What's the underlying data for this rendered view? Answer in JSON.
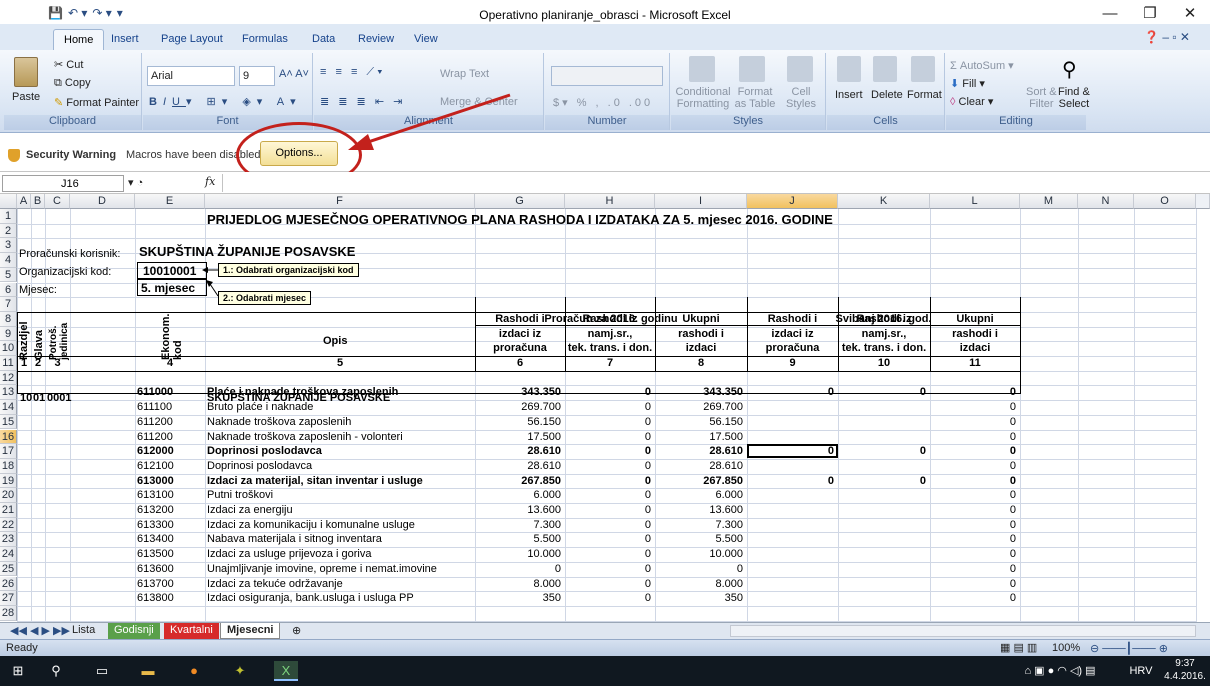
{
  "window": {
    "title": "Operativno planiranje_obrasci - Microsoft Excel",
    "controls": [
      "—",
      "❐",
      "✕"
    ]
  },
  "ribbon": {
    "tabs": [
      "Home",
      "Insert",
      "Page Layout",
      "Formulas",
      "Data",
      "Review",
      "View"
    ],
    "clipboard": {
      "paste": "Paste",
      "cut": "Cut",
      "copy": "Copy",
      "format_painter": "Format Painter",
      "group": "Clipboard"
    },
    "font": {
      "name": "Arial",
      "size": "9",
      "group": "Font"
    },
    "alignment": {
      "wrap": "Wrap Text",
      "merge": "Merge & Center",
      "group": "Alignment"
    },
    "number": {
      "group": "Number"
    },
    "styles": {
      "cond": "Conditional",
      "cond2": "Formatting",
      "fmt": "Format",
      "fmt2": "as Table",
      "cell": "Cell",
      "cell2": "Styles",
      "group": "Styles"
    },
    "cells": {
      "insert": "Insert",
      "delete": "Delete",
      "format": "Format",
      "group": "Cells"
    },
    "editing": {
      "autosum": "AutoSum",
      "fill": "Fill",
      "clear": "Clear",
      "sort": "Sort &",
      "sort2": "Filter",
      "find": "Find &",
      "find2": "Select",
      "group": "Editing"
    }
  },
  "security": {
    "title": "Security Warning",
    "message": "Macros have been disabled.",
    "button": "Options..."
  },
  "formula_bar": {
    "cell": "J16",
    "fx": "fx",
    "value": ""
  },
  "columns": [
    "A",
    "B",
    "C",
    "D",
    "E",
    "F",
    "G",
    "H",
    "I",
    "J",
    "K",
    "L",
    "M",
    "N",
    "O"
  ],
  "rows": [
    "1",
    "2",
    "3",
    "4",
    "5",
    "6",
    "7",
    "8",
    "9",
    "10",
    "11",
    "12",
    "13",
    "14",
    "15",
    "16",
    "17",
    "18",
    "19",
    "20",
    "21",
    "22",
    "23",
    "24",
    "25",
    "26",
    "27",
    "28"
  ],
  "sheet": {
    "title": "PRIJEDLOG MJESEČNOG OPERATIVNOG PLANA RASHODA I IZDATAKA ZA 5. mjesec 2016. GODINE",
    "korisnik_label": "Proračunski korisnik:",
    "korisnik": "SKUPŠTINA ŽUPANIJE POSAVSKE",
    "org_label": "Organizacijski kod:",
    "org": "10010001",
    "mj_label": "Mjesec:",
    "mj": "5. mjesec",
    "note1": "1.: Odabrati organizacijski kod",
    "note2": "2.: Odabrati mjesec",
    "hdr_razdjel": "Razdjel",
    "hdr_glava": "Glava",
    "hdr_potros": "Potroš. jedinica",
    "hdr_ekon": "Ekonom. kod",
    "hdr_opis": "Opis",
    "budget_hdr": "Proračun za 2016. godinu",
    "month_hdr": "Svibanj 2016. god.",
    "col_g": [
      "Rashodi i",
      "izdaci iz",
      "proračuna"
    ],
    "col_h": [
      "Rashodi iz",
      "namj.sr.,",
      "tek. trans. i don."
    ],
    "col_i": [
      "Ukupni",
      "rashodi i",
      "izdaci"
    ],
    "col_j": [
      "Rashodi i",
      "izdaci iz",
      "proračuna"
    ],
    "col_k": [
      "Rashodi iz",
      "namj.sr.,",
      "tek. trans. i don."
    ],
    "col_l": [
      "Ukupni",
      "rashodi i",
      "izdaci"
    ],
    "nums": [
      "1",
      "2",
      "3",
      "4",
      "5",
      "6",
      "7",
      "8",
      "9",
      "10",
      "11"
    ],
    "r12": {
      "a": "10",
      "b": "01",
      "c": "0001",
      "f": "SKUPŠTINA ŽUPANIJE POSAVSKE"
    },
    "data": [
      {
        "e": "611000",
        "f": "Plaće i naknade troškova zaposlenih",
        "g": "343.350",
        "h": "0",
        "i": "343.350",
        "j": "0",
        "k": "0",
        "l": "0",
        "bold": true
      },
      {
        "e": "611100",
        "f": "Bruto plaće i naknade",
        "g": "269.700",
        "h": "0",
        "i": "269.700",
        "j": "",
        "k": "",
        "l": "0"
      },
      {
        "e": "611200",
        "f": "Naknade troškova zaposlenih",
        "g": "56.150",
        "h": "0",
        "i": "56.150",
        "j": "",
        "k": "",
        "l": "0"
      },
      {
        "e": "611200",
        "f": "Naknade troškova zaposlenih - volonteri",
        "g": "17.500",
        "h": "0",
        "i": "17.500",
        "j": "",
        "k": "",
        "l": "0"
      },
      {
        "e": "612000",
        "f": "Doprinosi poslodavca",
        "g": "28.610",
        "h": "0",
        "i": "28.610",
        "j": "0",
        "k": "0",
        "l": "0",
        "bold": true
      },
      {
        "e": "612100",
        "f": "Doprinosi poslodavca",
        "g": "28.610",
        "h": "0",
        "i": "28.610",
        "j": "",
        "k": "",
        "l": "0"
      },
      {
        "e": "613000",
        "f": "Izdaci za materijal, sitan inventar i usluge",
        "g": "267.850",
        "h": "0",
        "i": "267.850",
        "j": "0",
        "k": "0",
        "l": "0",
        "bold": true
      },
      {
        "e": "613100",
        "f": "Putni troškovi",
        "g": "6.000",
        "h": "0",
        "i": "6.000",
        "j": "",
        "k": "",
        "l": "0"
      },
      {
        "e": "613200",
        "f": "Izdaci za energiju",
        "g": "13.600",
        "h": "0",
        "i": "13.600",
        "j": "",
        "k": "",
        "l": "0"
      },
      {
        "e": "613300",
        "f": "Izdaci za komunikaciju i komunalne usluge",
        "g": "7.300",
        "h": "0",
        "i": "7.300",
        "j": "",
        "k": "",
        "l": "0"
      },
      {
        "e": "613400",
        "f": "Nabava materijala i sitnog inventara",
        "g": "5.500",
        "h": "0",
        "i": "5.500",
        "j": "",
        "k": "",
        "l": "0"
      },
      {
        "e": "613500",
        "f": "Izdaci za usluge prijevoza i goriva",
        "g": "10.000",
        "h": "0",
        "i": "10.000",
        "j": "",
        "k": "",
        "l": "0"
      },
      {
        "e": "613600",
        "f": "Unajmljivanje imovine, opreme i nemat.imovine",
        "g": "0",
        "h": "0",
        "i": "0",
        "j": "",
        "k": "",
        "l": "0"
      },
      {
        "e": "613700",
        "f": "Izdaci za tekuće održavanje",
        "g": "8.000",
        "h": "0",
        "i": "8.000",
        "j": "",
        "k": "",
        "l": "0"
      },
      {
        "e": "613800",
        "f": "Izdaci osiguranja, bank.usluga i usluga PP",
        "g": "350",
        "h": "0",
        "i": "350",
        "j": "",
        "k": "",
        "l": "0"
      }
    ]
  },
  "sheet_tabs": [
    "Lista",
    "Godisnji",
    "Kvartalni",
    "Mjesecni"
  ],
  "status": {
    "ready": "Ready",
    "zoom": "100%"
  },
  "taskbar": {
    "lang": "HRV",
    "time": "9:37",
    "date": "4.4.2016."
  }
}
